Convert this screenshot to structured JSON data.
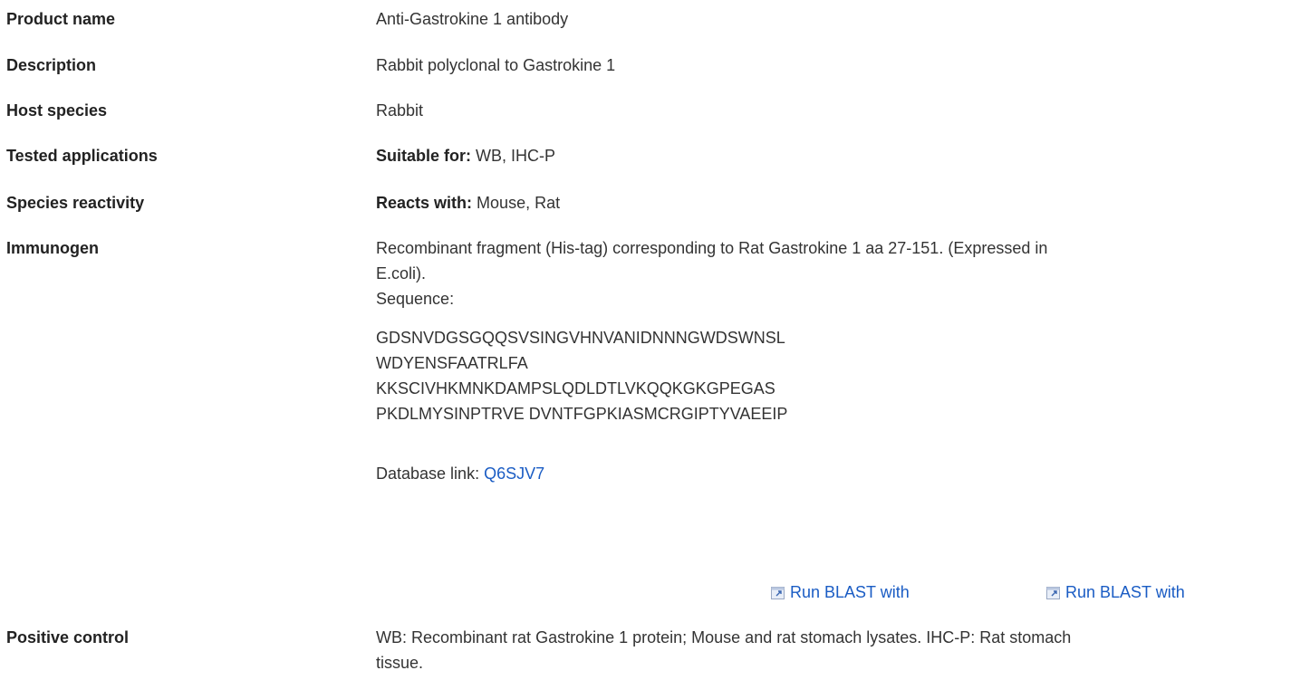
{
  "product_name": {
    "label": "Product name",
    "value": "Anti-Gastrokine 1 antibody"
  },
  "description": {
    "label": "Description",
    "value": "Rabbit polyclonal to Gastrokine 1"
  },
  "host_species": {
    "label": "Host species",
    "value": "Rabbit"
  },
  "tested_applications": {
    "label": "Tested applications",
    "prefix": "Suitable for:",
    "value": "WB, IHC-P"
  },
  "species_reactivity": {
    "label": "Species reactivity",
    "prefix": "Reacts with:",
    "value": "Mouse, Rat"
  },
  "immunogen": {
    "label": "Immunogen",
    "text_line1": "Recombinant fragment (His-tag) corresponding to Rat Gastrokine 1 aa 27-151. (Expressed in",
    "text_line2": "E.coli).",
    "sequence_label": "Sequence:",
    "sequence_lines": [
      "GDSNVDGSGQQSVSINGVHNVANIDNNNGWDSWNSL",
      "WDYENSFAATRLFA",
      "KKSCIVHKMNKDAMPSLQDLDTLVKQQKGKGPEGAS",
      "PKDLMYSINPTRVE DVNTFGPKIASMCRGIPTYVAEEIP"
    ],
    "database_link_label": "Database link:",
    "database_link_value": "Q6SJV7",
    "blast_links": [
      "Run BLAST with",
      "Run BLAST with"
    ],
    "blast_icon": "external-link-icon"
  },
  "positive_control": {
    "label": "Positive control",
    "text_line1": "WB: Recombinant rat Gastrokine 1 protein; Mouse and rat stomach lysates. IHC-P: Rat stomach",
    "text_line2": "tissue."
  },
  "colors": {
    "text": "#333333",
    "label": "#222222",
    "link": "#1a5cc4"
  }
}
